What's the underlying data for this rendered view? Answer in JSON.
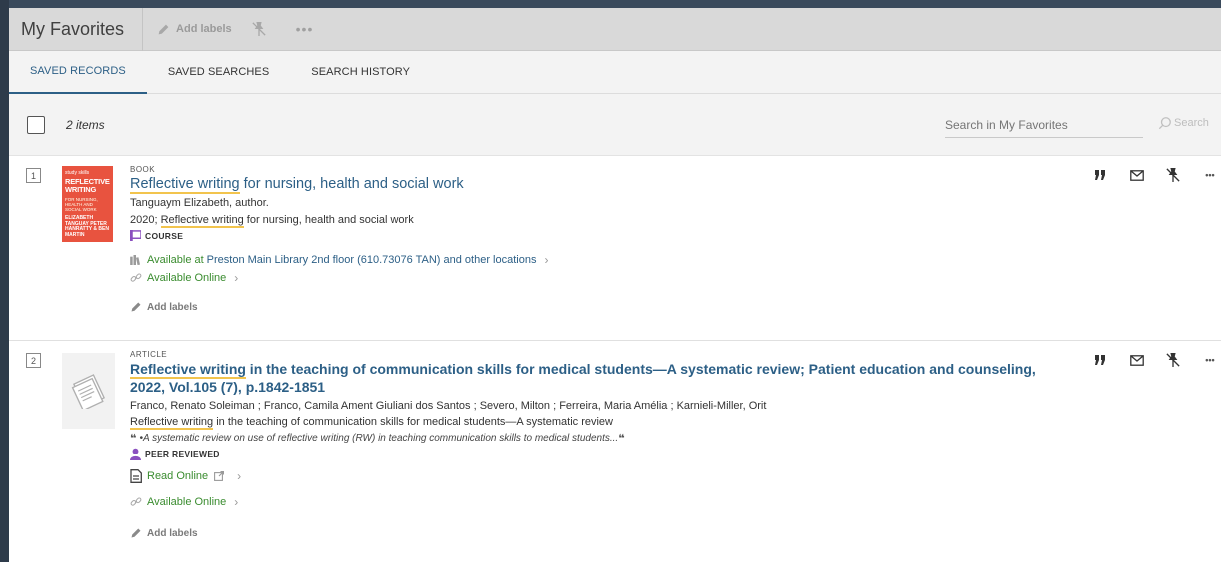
{
  "header": {
    "title": "My Favorites",
    "add_labels": "Add labels",
    "more": "•••"
  },
  "tabs": [
    {
      "label": "SAVED RECORDS",
      "active": true
    },
    {
      "label": "SAVED SEARCHES",
      "active": false
    },
    {
      "label": "SEARCH HISTORY",
      "active": false
    }
  ],
  "toolbar": {
    "items_count": "2 items",
    "search_placeholder": "Search in My Favorites",
    "search_button": "Search"
  },
  "records": [
    {
      "number": "1",
      "type": "BOOK",
      "title_highlight": "Reflective writing",
      "title_rest": " for nursing, health and social work",
      "author": "Tanguaym Elizabeth, author.",
      "pub_prefix": "2020; ",
      "pub_highlight": "Reflective writing",
      "pub_rest": " for nursing, health and social work",
      "badge": "COURSE",
      "availability_status": "Available at",
      "availability_location": "Preston Main Library  2nd floor (610.73076 TAN) and other locations",
      "online": "Available Online",
      "add_labels": "Add labels",
      "cover": {
        "top": "study skills",
        "title": "REFLECTIVE WRITING",
        "subtitle": "FOR NURSING, HEALTH AND SOCIAL WORK",
        "authors": "ELIZABETH TANGUAY PETER HANRATTY & BEN MARTIN"
      }
    },
    {
      "number": "2",
      "type": "ARTICLE",
      "title_highlight": "Reflective writing",
      "title_rest": " in the teaching of communication skills for medical students—A systematic review; Patient education and counseling, 2022, Vol.105 (7), p.1842-1851",
      "authors": "Franco, Renato Soleiman ; Franco, Camila Ament Giuliani dos Santos ; Severo, Milton ; Ferreira, Maria Amélia ; Karnieli-Miller, Orit",
      "subtitle_highlight": "Reflective writing",
      "subtitle_rest": " in the teaching of communication skills for medical students—A systematic review",
      "snippet": "•A systematic review on use of reflective writing (RW) in teaching communication skills to medical students...",
      "badge": "PEER REVIEWED",
      "read_online": "Read Online",
      "online": "Available Online",
      "add_labels": "Add labels"
    }
  ],
  "actions": {
    "cite": "”",
    "more": "•••"
  },
  "colors": {
    "link": "#2c5f86",
    "available": "#3a8c2f",
    "highlight": "#f2c44d",
    "header_bg": "#d9d9d9"
  }
}
